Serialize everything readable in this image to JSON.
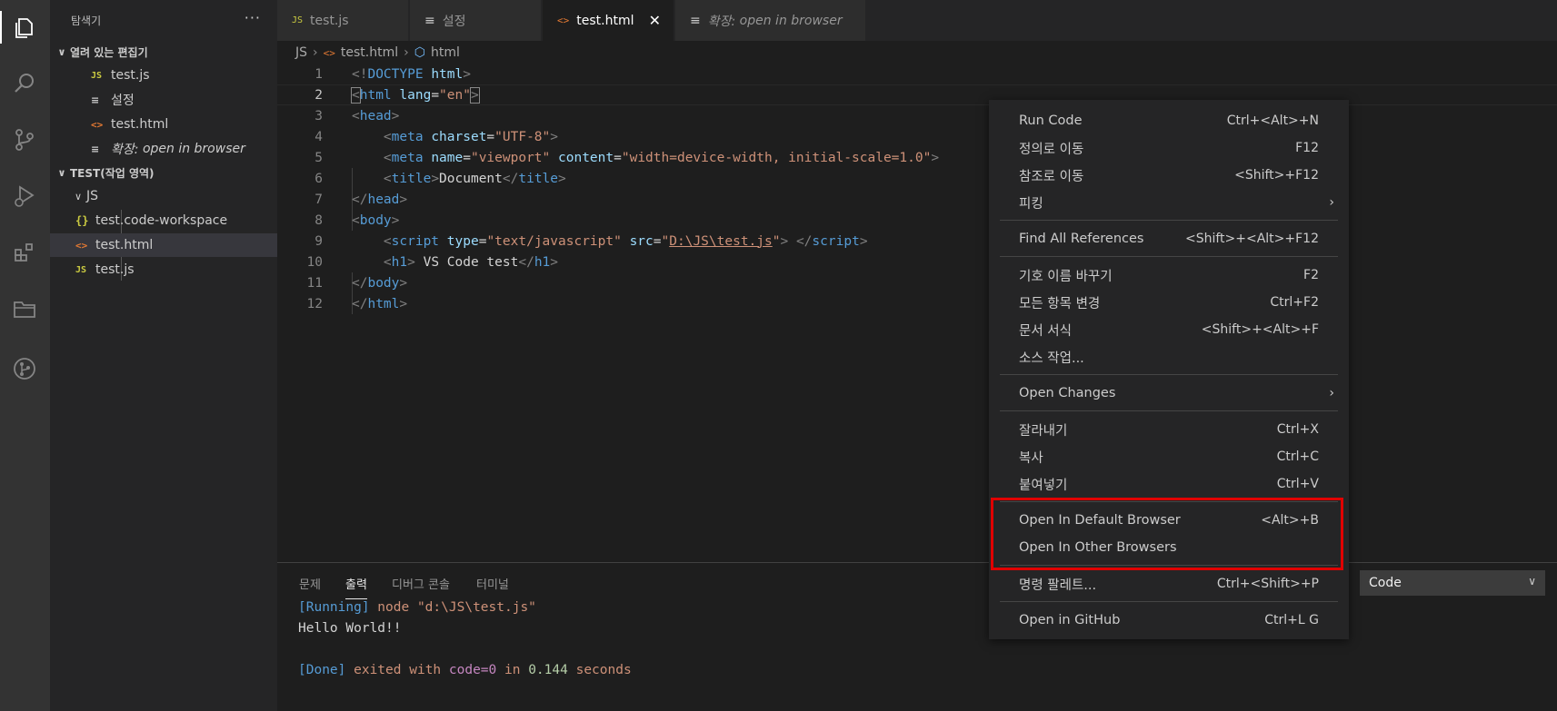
{
  "activity_bar": {
    "icons": [
      "explorer-icon",
      "search-icon",
      "source-control-icon",
      "run-debug-icon",
      "extensions-icon",
      "folder-icon",
      "git-graph-icon"
    ]
  },
  "sidebar": {
    "title": "탐색기",
    "more": "···",
    "open_editors": {
      "header": "열려 있는 편집기",
      "items": [
        {
          "icon": "JS",
          "label": "test.js"
        },
        {
          "icon": "≡",
          "label": "설정"
        },
        {
          "icon": "<>",
          "label": "test.html"
        },
        {
          "icon": "≡",
          "label_prefix": "확장:",
          "label": "open in browser"
        }
      ]
    },
    "workspace": {
      "header": "TEST(작업 영역)",
      "folder": "JS",
      "items": [
        {
          "icon": "{}",
          "label": "test.code-workspace"
        },
        {
          "icon": "<>",
          "label": "test.html"
        },
        {
          "icon": "JS",
          "label": "test.js"
        }
      ]
    }
  },
  "tabs": [
    {
      "icon": "JS",
      "label": "test.js"
    },
    {
      "icon": "≡",
      "label": "설정"
    },
    {
      "icon": "<>",
      "label": "test.html",
      "close": "✕"
    },
    {
      "icon": "≡",
      "label_prefix": "확장:",
      "label": "open in browser"
    }
  ],
  "breadcrumb": [
    "JS",
    "test.html",
    "html"
  ],
  "editor": {
    "current_line": 2,
    "lines": [
      "1",
      "2",
      "3",
      "4",
      "5",
      "6",
      "7",
      "8",
      "9",
      "10",
      "11",
      "12"
    ]
  },
  "panel": {
    "tabs": [
      "문제",
      "출력",
      "디버그 콘솔",
      "터미널"
    ],
    "active_tab": "출력",
    "output_channel": "Code",
    "output": {
      "running_tag": "[Running]",
      "running_cmd": " node \"d:\\JS\\test.js\"",
      "hello": "Hello World!!",
      "done_tag": "[Done]",
      "done_exited": " exited with ",
      "done_code": "code=0",
      "done_in": " in ",
      "done_time": "0.144",
      "done_seconds": " seconds"
    }
  },
  "context_menu": {
    "items": [
      {
        "label": "Run Code",
        "key": "Ctrl+<Alt>+N"
      },
      {
        "label": "정의로 이동",
        "key": "F12"
      },
      {
        "label": "참조로 이동",
        "key": "<Shift>+F12"
      },
      {
        "label": "피킹",
        "submenu": "›"
      },
      {
        "label": "Find All References",
        "key": "<Shift>+<Alt>+F12"
      },
      {
        "label": "기호 이름 바꾸기",
        "key": "F2"
      },
      {
        "label": "모든 항목 변경",
        "key": "Ctrl+F2"
      },
      {
        "label": "문서 서식",
        "key": "<Shift>+<Alt>+F"
      },
      {
        "label": "소스 작업..."
      },
      {
        "label": "Open Changes",
        "submenu": "›"
      },
      {
        "label": "잘라내기",
        "key": "Ctrl+X"
      },
      {
        "label": "복사",
        "key": "Ctrl+C"
      },
      {
        "label": "붙여넣기",
        "key": "Ctrl+V"
      },
      {
        "label": "Open In Default Browser",
        "key": "<Alt>+B"
      },
      {
        "label": "Open In Other Browsers"
      },
      {
        "label": "명령 팔레트...",
        "key": "Ctrl+<Shift>+P"
      },
      {
        "label": "Open in GitHub",
        "key": "Ctrl+L G"
      }
    ]
  },
  "colors": {
    "highlight_box": "#e00000",
    "accent_blue": "#569cd6",
    "string_orange": "#ce9178"
  }
}
